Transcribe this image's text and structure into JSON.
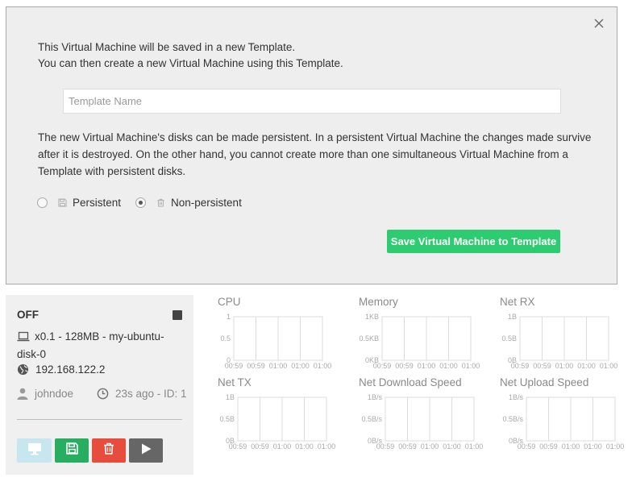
{
  "dialog": {
    "intro_line1": "This Virtual Machine will be saved in a new Template.",
    "intro_line2": "You can then create a new Virtual Machine using this Template.",
    "template_name_placeholder": "Template Name",
    "template_name_value": "",
    "persistence_text": "The new Virtual Machine's disks can be made persistent. In a persistent Virtual Machine the changes made survive after it is destroyed. On the other hand, you cannot create more than one simultaneous Virtual Machine from a Template with persistent disks.",
    "options": [
      {
        "label": "Persistent",
        "icon": "floppy-disk-icon",
        "checked": false
      },
      {
        "label": "Non-persistent",
        "icon": "trash-icon",
        "checked": true
      }
    ],
    "save_label": "Save Virtual Machine to Template",
    "accent_color": "#2ecc71"
  },
  "vm": {
    "state": "OFF",
    "spec": "x0.1 - 128MB - my-ubuntu-disk-0",
    "ip": "192.168.122.2",
    "owner": "johndoe",
    "time": "23s ago - ID: 1",
    "buttons": [
      {
        "name": "vnc-button",
        "icon": "monitor-icon",
        "color": "#c7e6f0"
      },
      {
        "name": "save-template-button",
        "icon": "floppy-disk-icon",
        "color": "#27ae60"
      },
      {
        "name": "delete-button",
        "icon": "trash-icon",
        "color": "#e74c3c"
      },
      {
        "name": "play-button",
        "icon": "play-icon",
        "color": "#666666"
      }
    ]
  },
  "charts": {
    "cpu": {
      "title": "CPU",
      "y_ticks": [
        "1",
        "0.5",
        "0"
      ],
      "x_ticks": [
        "00:59",
        "00:59",
        "01:00",
        "01:00",
        "01:00"
      ]
    },
    "memory": {
      "title": "Memory",
      "y_ticks": [
        "1KB",
        "0.5KB",
        "0KB"
      ],
      "x_ticks": [
        "00:59",
        "00:59",
        "01:00",
        "01:00",
        "01:00"
      ]
    },
    "net_rx": {
      "title": "Net RX",
      "y_ticks": [
        "1B",
        "0.5B",
        "0B"
      ],
      "x_ticks": [
        "00:59",
        "00:59",
        "01:00",
        "01:00",
        "01:00"
      ]
    },
    "net_tx": {
      "title": "Net TX",
      "y_ticks": [
        "1B",
        "0.5B",
        "0B"
      ],
      "x_ticks": [
        "00:59",
        "00:59",
        "01:00",
        "01:00",
        "01:00"
      ]
    },
    "net_download": {
      "title": "Net Download Speed",
      "y_ticks": [
        "1B/s",
        "0.5B/s",
        "0B/s"
      ],
      "x_ticks": [
        "00:59",
        "00:59",
        "01:00",
        "01:00",
        "01:00"
      ]
    },
    "net_upload": {
      "title": "Net Upload Speed",
      "y_ticks": [
        "1B/s",
        "0.5B/s",
        "0B/s"
      ],
      "x_ticks": [
        "00:59",
        "00:59",
        "01:00",
        "01:00",
        "01:00"
      ]
    }
  }
}
